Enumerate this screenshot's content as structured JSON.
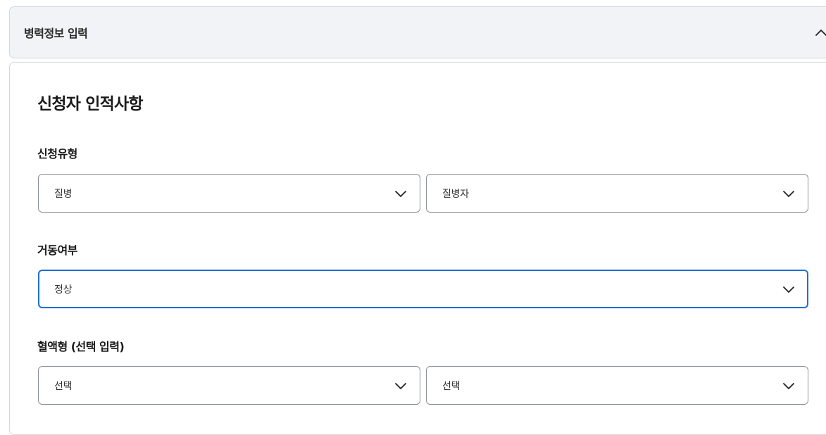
{
  "accordion": {
    "title": "병력정보 입력",
    "toggle_icon": "chevron-up-icon",
    "expanded": true
  },
  "section": {
    "title": "신청자 인적사항"
  },
  "fields": {
    "application_type": {
      "label": "신청유형",
      "select1_value": "질병",
      "select2_value": "질병자"
    },
    "mobility": {
      "label": "거동여부",
      "select_value": "정상"
    },
    "blood_type": {
      "label": "혈액형 (선택 입력)",
      "select1_value": "선택",
      "select2_value": "선택"
    }
  },
  "colors": {
    "header_bg": "#f1f3f6",
    "border": "#8a8f96",
    "focus_border": "#1f6fd1"
  }
}
